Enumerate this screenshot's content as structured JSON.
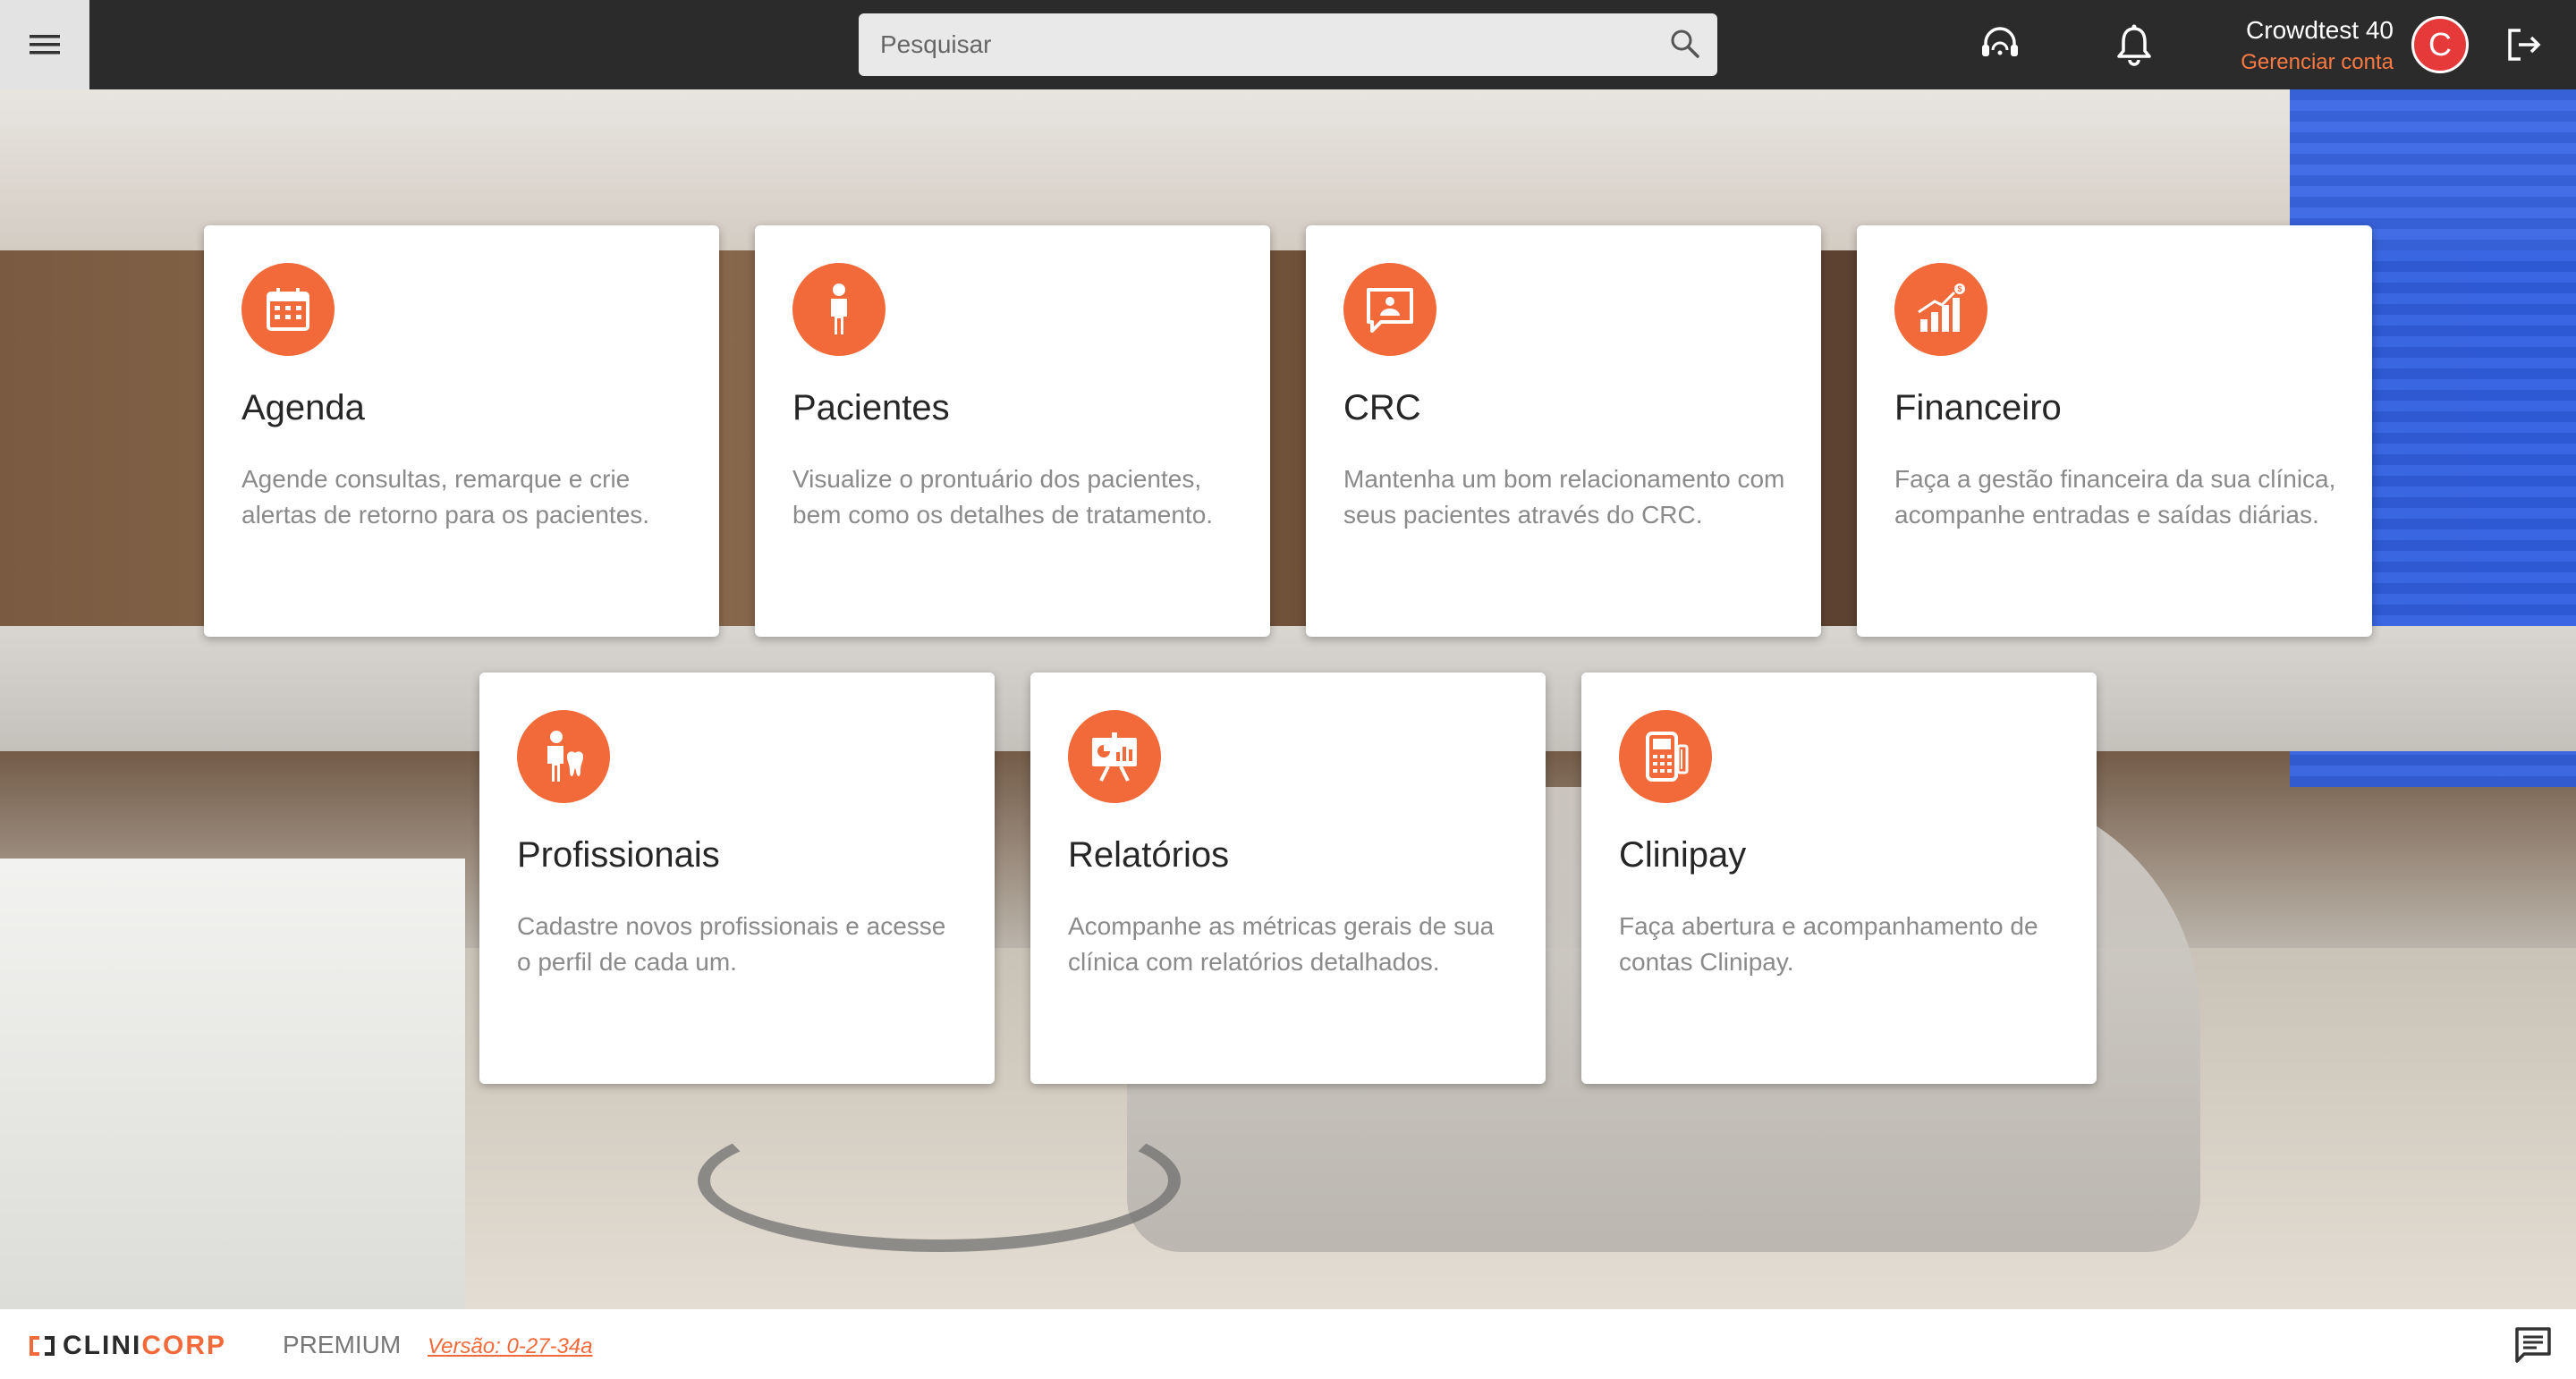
{
  "header": {
    "search_placeholder": "Pesquisar",
    "user_name": "Crowdtest 40",
    "manage_account": "Gerenciar conta",
    "avatar_initial": "C",
    "icons": [
      "menu-icon",
      "search-icon",
      "support-headset-icon",
      "bell-icon",
      "logout-icon"
    ]
  },
  "cards": [
    {
      "title": "Agenda",
      "desc": "Agende consultas, remarque e crie alertas de retorno para os pacientes.",
      "icon": "calendar-icon"
    },
    {
      "title": "Pacientes",
      "desc": "Visualize o prontuário dos pacientes, bem como os detalhes de tratamento.",
      "icon": "person-icon"
    },
    {
      "title": "CRC",
      "desc": "Mantenha um bom relacionamento com seus pacientes através do CRC.",
      "icon": "chat-person-icon"
    },
    {
      "title": "Financeiro",
      "desc": "Faça a gestão financeira da sua clínica, acompanhe entradas e saídas diárias.",
      "icon": "growth-chart-icon"
    },
    {
      "title": "Profissionais",
      "desc": "Cadastre novos profissionais e acesse o perfil de cada um.",
      "icon": "dentist-icon"
    },
    {
      "title": "Relatórios",
      "desc": "Acompanhe as métricas gerais de sua clínica com relatórios detalhados.",
      "icon": "presentation-icon"
    },
    {
      "title": "Clinipay",
      "desc": "Faça abertura e acompanhamento de contas Clinipay.",
      "icon": "card-machine-icon"
    }
  ],
  "footer": {
    "logo_part1": "CLINI",
    "logo_part2": "CORP",
    "plan": "PREMIUM",
    "version": "Versão: 0-27-34a"
  },
  "colors": {
    "accent": "#f26a3a",
    "topbar": "#2b2b2b",
    "avatar": "#e63a3a"
  }
}
